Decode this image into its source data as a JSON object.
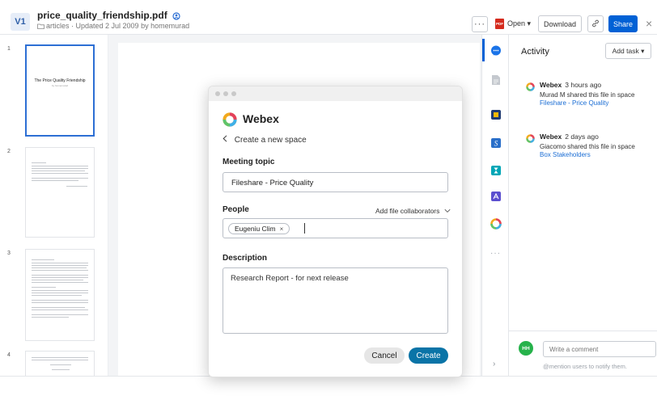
{
  "header": {
    "version": "V1",
    "file_name": "price_quality_friendship.pdf",
    "meta": "articles · Updated 2 Jul 2009 by homemurad",
    "more_label": "···",
    "open_label": "Open ▾",
    "pdf_badge": "PDF",
    "download_label": "Download",
    "share_label": "Share",
    "close_label": "×"
  },
  "thumbnails": {
    "pages": [
      "1",
      "2",
      "3",
      "4"
    ],
    "page1_title": "The Price Quality Friendship",
    "page1_subtitle": "by homemurad"
  },
  "rail": {
    "dots": "···",
    "chevron": "›"
  },
  "activity": {
    "title": "Activity",
    "add_task_label": "Add task ▾",
    "items": [
      {
        "app": "Webex",
        "time": "3 hours ago",
        "text": "Murad M shared this file in space",
        "link": "Fileshare - Price Quality"
      },
      {
        "app": "Webex",
        "time": "2 days ago",
        "text": "Giacomo shared this file in space",
        "link": "Box Stakeholders"
      }
    ],
    "avatar_initials": "HH",
    "comment_placeholder": "Write a comment",
    "comment_hint": "@mention users to notify them."
  },
  "modal": {
    "app_title": "Webex",
    "back_label": "Create a new space",
    "topic_label": "Meeting topic",
    "topic_value": "Fileshare -  Price Quality",
    "people_label": "People",
    "add_collaborators_label": "Add file collaborators",
    "people_chip": "Eugeniu Clim",
    "chip_remove": "×",
    "description_label": "Description",
    "description_value": "Research Report - for next release",
    "cancel_label": "Cancel",
    "create_label": "Create"
  },
  "colors": {
    "accent": "#0061d5",
    "webex_create": "#0a74a7",
    "avatar": "#26b24b",
    "link": "#1a6dd4"
  }
}
